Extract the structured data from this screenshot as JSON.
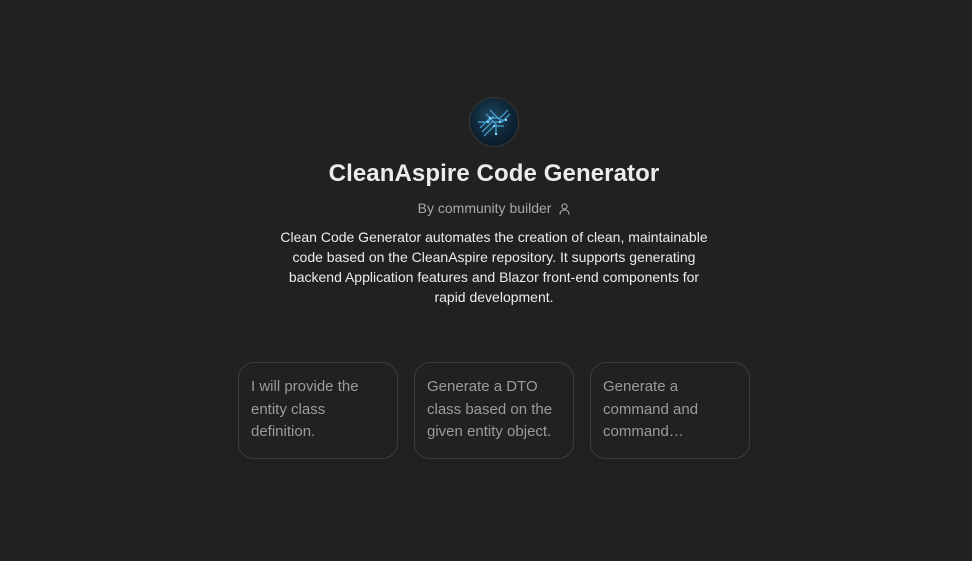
{
  "gpt": {
    "avatar_icon": "circuit-board-icon",
    "title": "CleanAspire Code Generator",
    "byline": "By community builder",
    "byline_icon": "person-icon",
    "description": "Clean Code Generator automates the creation of clean, maintainable code based on the CleanAspire repository. It supports generating backend Application features and Blazor front-end components for rapid development."
  },
  "starters": [
    {
      "text": "I will provide the entity class definition."
    },
    {
      "text": "Generate a DTO class based on the given entity object."
    },
    {
      "text": "Generate a command and command handler…"
    }
  ],
  "colors": {
    "background": "#212121",
    "title": "#ececec",
    "muted": "#a8a8a8",
    "card_border": "#3d3d3d"
  }
}
